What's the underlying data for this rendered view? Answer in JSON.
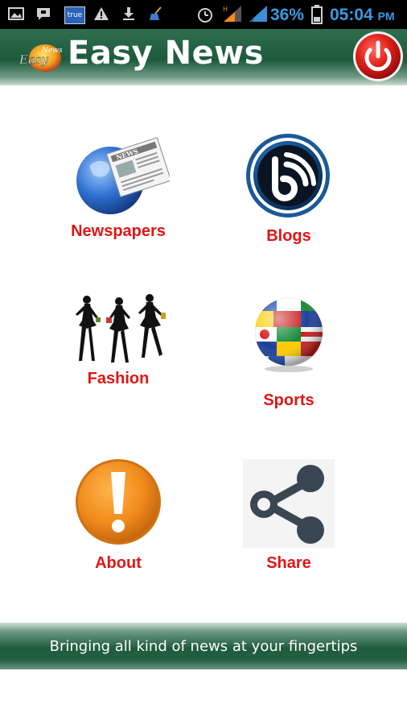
{
  "status_bar": {
    "battery_percent": "36%",
    "time": "05:04",
    "ampm": "PM",
    "carrier_badge": "true",
    "icons": [
      "gallery-icon",
      "message-icon",
      "truecaller-icon",
      "warning-icon",
      "download-icon",
      "broom-icon",
      "alarm-icon",
      "signal-icon",
      "signal-icon",
      "battery-icon"
    ]
  },
  "header": {
    "title": "Easy News",
    "logo_text": "Easy News",
    "power_button_icon": "power-icon"
  },
  "menu": {
    "items": [
      {
        "label": "Newspapers",
        "icon": "globe-newspaper-icon"
      },
      {
        "label": "Blogs",
        "icon": "rss-feed-icon"
      },
      {
        "label": "Fashion",
        "icon": "fashion-silhouettes-icon"
      },
      {
        "label": "Sports",
        "icon": "flag-ball-icon"
      },
      {
        "label": "About",
        "icon": "exclamation-icon"
      },
      {
        "label": "Share",
        "icon": "share-icon"
      }
    ]
  },
  "footer": {
    "tagline": "Bringing all kind of news at your fingertips"
  },
  "colors": {
    "header_green": "#1d5a3c",
    "label_red": "#e01616",
    "power_red": "#d91a1a",
    "about_orange": "#f08a1c",
    "share_gray": "#3a4652"
  }
}
